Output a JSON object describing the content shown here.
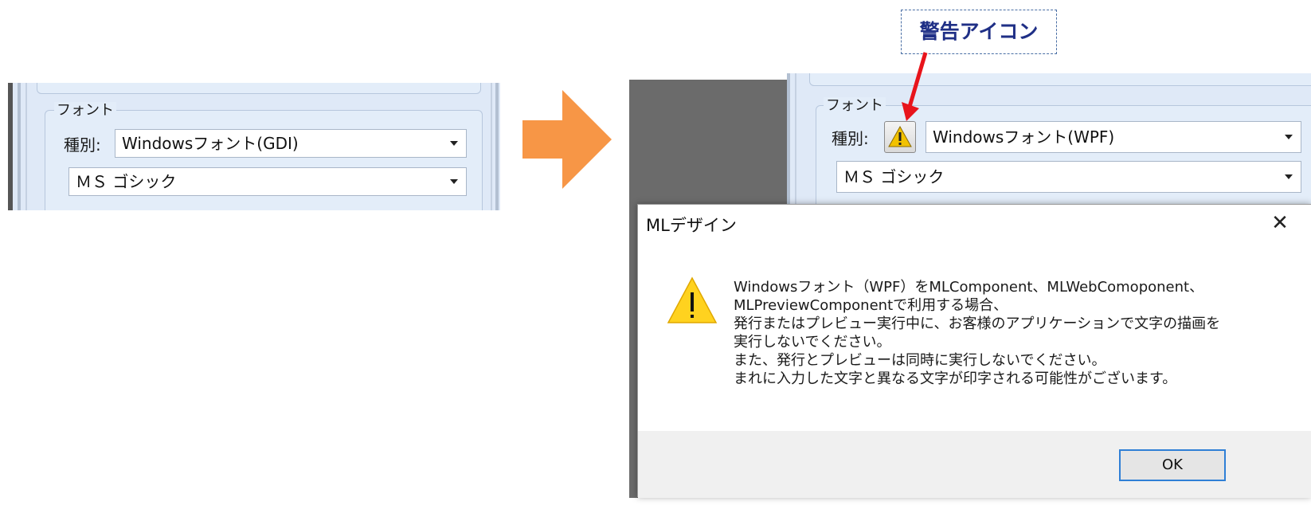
{
  "callout": {
    "text": "警告アイコン"
  },
  "before": {
    "group_title": "フォント",
    "type_label": "種別:",
    "type_value": "Windowsフォント(GDI)",
    "font_value": "ＭＳ ゴシック"
  },
  "after": {
    "group_title": "フォント",
    "type_label": "種別:",
    "type_value": "Windowsフォント(WPF)",
    "font_value": "ＭＳ ゴシック"
  },
  "dialog": {
    "title": "MLデザイン",
    "close": "✕",
    "message_lines": [
      "Windowsフォント（WPF）をMLComponent、MLWebComoponent、",
      "MLPreviewComponentで利用する場合、",
      "発行またはプレビュー実行中に、お客様のアプリケーションで文字の描画を",
      "実行しないでください。",
      "また、発行とプレビューは同時に実行しないでください。",
      "まれに入力した文字と異なる文字が印字される可能性がございます。"
    ],
    "ok_label": "OK"
  },
  "colors": {
    "arrow": "#f79646",
    "callout_arrow": "#e8141b",
    "warning_yellow": "#ffd21f"
  },
  "icons": [
    "warning-icon",
    "close-icon",
    "dropdown-arrow-icon",
    "right-arrow-icon"
  ]
}
